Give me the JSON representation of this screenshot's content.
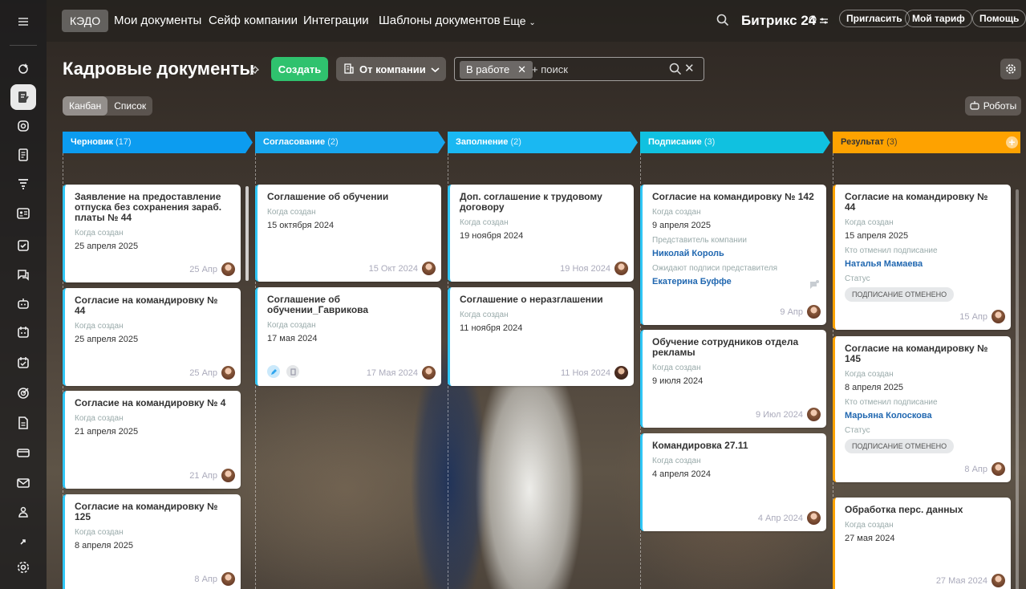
{
  "topnav": {
    "items": [
      "КЭДО",
      "Мои документы",
      "Сейф компании",
      "Интеграции",
      "Шаблоны документов",
      "Еще"
    ],
    "logo": "Битрикс",
    "logo_num": "24",
    "invite": "Пригласить",
    "tariff": "Мой тариф",
    "help": "Помощь"
  },
  "page": {
    "title": "Кадровые документы",
    "create": "Создать",
    "company": "От компании",
    "filter_chip": "В работе",
    "search_placeholder": "+ поиск",
    "view_kanban": "Канбан",
    "view_list": "Список",
    "robots": "Роботы"
  },
  "colors": {
    "draft": "#0c9cf0",
    "approve": "#17a6ee",
    "fill": "#1ab8f2",
    "sign": "#10c1e0",
    "result": "#fea200",
    "accent": "#2fc26e"
  },
  "columns": [
    {
      "name": "Черновик",
      "count": "(17)",
      "cards": [
        {
          "title": "Заявление на предоставление отпуска без сохранения зараб. платы № 44",
          "fields": [
            {
              "label": "Когда создан",
              "value": "25 апреля 2025"
            }
          ],
          "date": "25 Апр"
        },
        {
          "title": "Согласие на командировку № 44",
          "fields": [
            {
              "label": "Когда создан",
              "value": "25 апреля 2025"
            }
          ],
          "date": "25 Апр"
        },
        {
          "title": "Согласие на командировку № 4",
          "fields": [
            {
              "label": "Когда создан",
              "value": "21 апреля 2025"
            }
          ],
          "date": "21 Апр"
        },
        {
          "title": "Согласие на командировку № 125",
          "fields": [
            {
              "label": "Когда создан",
              "value": "8 апреля 2025"
            }
          ],
          "date": "8 Апр"
        }
      ]
    },
    {
      "name": "Согласование",
      "count": "(2)",
      "cards": [
        {
          "title": "Соглашение об обучении",
          "fields": [
            {
              "label": "Когда создан",
              "value": "15 октября 2024"
            }
          ],
          "date": "15 Окт 2024"
        },
        {
          "title": "Соглашение об обучении_Гаврикова",
          "fields": [
            {
              "label": "Когда создан",
              "value": "17 мая 2024"
            }
          ],
          "date": "17 Мая 2024"
        }
      ]
    },
    {
      "name": "Заполнение",
      "count": "(2)",
      "cards": [
        {
          "title": "Доп. соглашение к трудовому договору",
          "fields": [
            {
              "label": "Когда создан",
              "value": "19 ноября 2024"
            }
          ],
          "date": "19 Ноя 2024"
        },
        {
          "title": "Соглашение о неразглашении",
          "fields": [
            {
              "label": "Когда создан",
              "value": "11 ноября 2024"
            }
          ],
          "date": "11 Ноя 2024"
        }
      ]
    },
    {
      "name": "Подписание",
      "count": "(3)",
      "cards": [
        {
          "title": "Согласие на командировку № 142",
          "fields": [
            {
              "label": "Когда создан",
              "value": "9 апреля 2025"
            },
            {
              "label": "Представитель компании",
              "value": "Николай Король"
            },
            {
              "label": "Ожидают подписи представителя",
              "value": "Екатерина Буффе"
            }
          ],
          "date": "9 Апр"
        },
        {
          "title": "Обучение сотрудников отдела рекламы",
          "fields": [
            {
              "label": "Когда создан",
              "value": "9 июля 2024"
            }
          ],
          "date": "9 Июл 2024"
        },
        {
          "title": "Командировка 27.11",
          "fields": [
            {
              "label": "Когда создан",
              "value": "4 апреля 2024"
            }
          ],
          "date": "4 Апр 2024"
        }
      ]
    },
    {
      "name": "Результат",
      "count": "(3)",
      "cards": [
        {
          "title": "Согласие на командировку № 44",
          "fields": [
            {
              "label": "Когда создан",
              "value": "15 апреля 2025"
            },
            {
              "label": "Кто отменил подписание",
              "value": "Наталья Мамаева"
            },
            {
              "label": "Статус",
              "value": "ПОДПИСАНИЕ ОТМЕНЕНО"
            }
          ],
          "date": "15 Апр"
        },
        {
          "title": "Согласие на командировку № 145",
          "fields": [
            {
              "label": "Когда создан",
              "value": "8 апреля 2025"
            },
            {
              "label": "Кто отменил подписание",
              "value": "Марьяна Колоскова"
            },
            {
              "label": "Статус",
              "value": "ПОДПИСАНИЕ ОТМЕНЕНО"
            }
          ],
          "date": "8 Апр"
        },
        {
          "title": "Обработка перс. данных",
          "fields": [
            {
              "label": "Когда создан",
              "value": "27 мая 2024"
            }
          ],
          "date": "27 Мая 2024"
        }
      ]
    }
  ]
}
